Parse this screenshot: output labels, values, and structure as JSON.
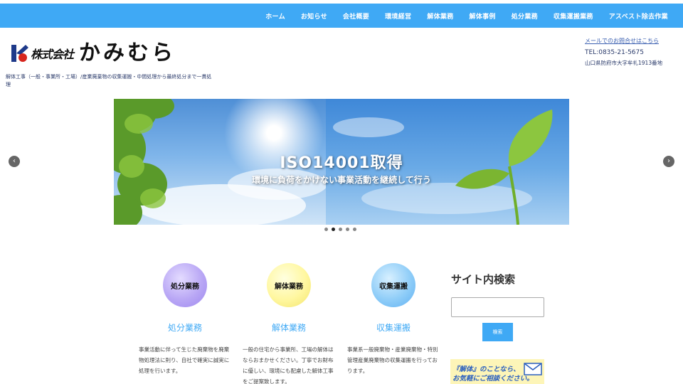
{
  "nav": {
    "items": [
      "ホーム",
      "お知らせ",
      "会社概要",
      "環境経営",
      "解体業務",
      "解体事例",
      "処分業務",
      "収集運搬業務",
      "アスベスト除去作業"
    ]
  },
  "header": {
    "logo_corp": "株式会社",
    "logo_name": "かみむら",
    "tagline": "解体工事（一般・事業所・工場）/産業廃棄物の収集運搬・中間処理から最終処分まで一貫処理",
    "mail_link": "メールでのお問合せはこちら",
    "tel": "TEL:0835-21-5675",
    "address": "山口県防府市大字牟礼1913番地"
  },
  "slider": {
    "title": "ISO14001取得",
    "subtitle": "環境に負荷をかけない事業活動を継続して行う",
    "prev_label": "‹",
    "next_label": "›",
    "dot_count": 5,
    "active_dot": 1
  },
  "services": [
    {
      "circle_label": "処分業務",
      "title": "処分業務",
      "desc": "事業活動に伴って生じた廃棄物を廃棄物処理法に則り、自社で確実に誠実に処理を行います。"
    },
    {
      "circle_label": "解体業務",
      "title": "解体業務",
      "desc": "一般の住宅から事業所、工場の解体はならおまかせください。丁寧でお財布に優しい、環境にも配慮した解体工事をご提案致します。"
    },
    {
      "circle_label": "収集運搬",
      "title": "収集運搬",
      "desc": "事業系一般廃棄物・産業廃棄物・特別管理産業廃棄物の収集運搬を行っております。"
    }
  ],
  "sidebar": {
    "search_title": "サイト内検索",
    "search_button": "検索",
    "banner_line1": "『解体』のことなら、",
    "banner_line2": "お気軽にご相談ください。"
  },
  "colors": {
    "accent": "#3fa9f5",
    "logo_red": "#d7261e",
    "logo_navy": "#1e3a8a"
  }
}
